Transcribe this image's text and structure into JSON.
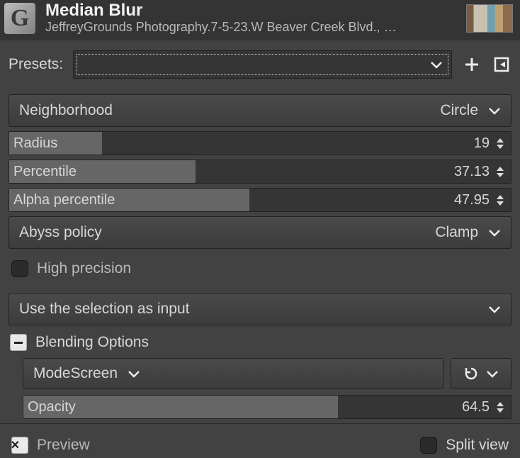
{
  "header": {
    "title": "Median Blur",
    "subtitle": "JeffreyGrounds Photography.7-5-23.W Beaver Creek Blvd., …"
  },
  "presets": {
    "label": "Presets:"
  },
  "neighborhood": {
    "label": "Neighborhood",
    "value": "Circle"
  },
  "radius": {
    "label": "Radius",
    "value": "19",
    "fillPct": 18.5
  },
  "percentile": {
    "label": "Percentile",
    "value": "37.13",
    "fillPct": 37.13
  },
  "alpha_percentile": {
    "label": "Alpha percentile",
    "value": "47.95",
    "fillPct": 47.95
  },
  "abyss": {
    "label": "Abyss policy",
    "value": "Clamp"
  },
  "high_precision": {
    "label": "High precision",
    "checked": false
  },
  "selection_input": {
    "label": "Use the selection as input"
  },
  "blending": {
    "section_label": "Blending Options",
    "mode_label": "Mode",
    "mode_value": "Screen",
    "opacity_label": "Opacity",
    "opacity_value": "64.5",
    "opacity_fillPct": 64.5
  },
  "footer": {
    "preview_label": "Preview",
    "preview_checked": true,
    "split_label": "Split view",
    "split_checked": false
  }
}
